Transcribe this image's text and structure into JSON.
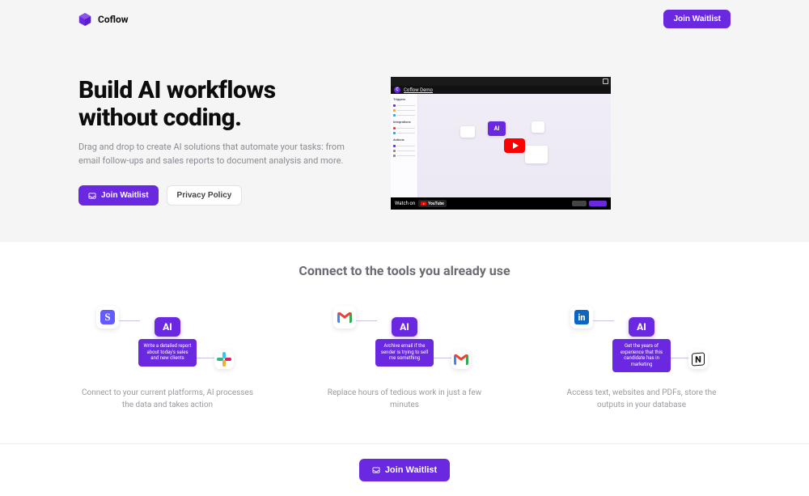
{
  "brand": {
    "name": "Coflow"
  },
  "nav": {
    "cta_label": "Join Waitlist"
  },
  "hero": {
    "title_line1": "Build AI workflows",
    "title_line2": "without coding.",
    "subtitle": "Drag and drop to create AI solutions that automate your tasks: from email follow-ups and sales reports to document analysis and more.",
    "primary_cta": "Join Waitlist",
    "secondary_cta": "Privacy Policy"
  },
  "video": {
    "channel_initial": "C",
    "title": "Coflow Demo",
    "watch_on": "Watch on",
    "youtube": "YouTube",
    "sidebar_headings": [
      "Triggers",
      "Integrations",
      "Actions"
    ]
  },
  "tools": {
    "heading": "Connect to the tools you already use",
    "ai_label": "AI",
    "columns": [
      {
        "left_app": "stripe",
        "right_app": "slack",
        "ai_card": "Write a detailed report about today's sales and new clients",
        "caption": "Connect to your current platforms, AI processes the data and takes action"
      },
      {
        "left_app": "gmail",
        "right_app": "gmail",
        "ai_card": "Archive email if the sender is trying to sell me something",
        "caption": "Replace hours of tedious work in just a few minutes"
      },
      {
        "left_app": "linkedin",
        "right_app": "notion",
        "ai_card": "Get the years of experience that this candidate has in marketing",
        "caption": "Access text, websites and PDFs, store the outputs in your database"
      }
    ]
  },
  "footer": {
    "cta_label": "Join Waitlist"
  }
}
